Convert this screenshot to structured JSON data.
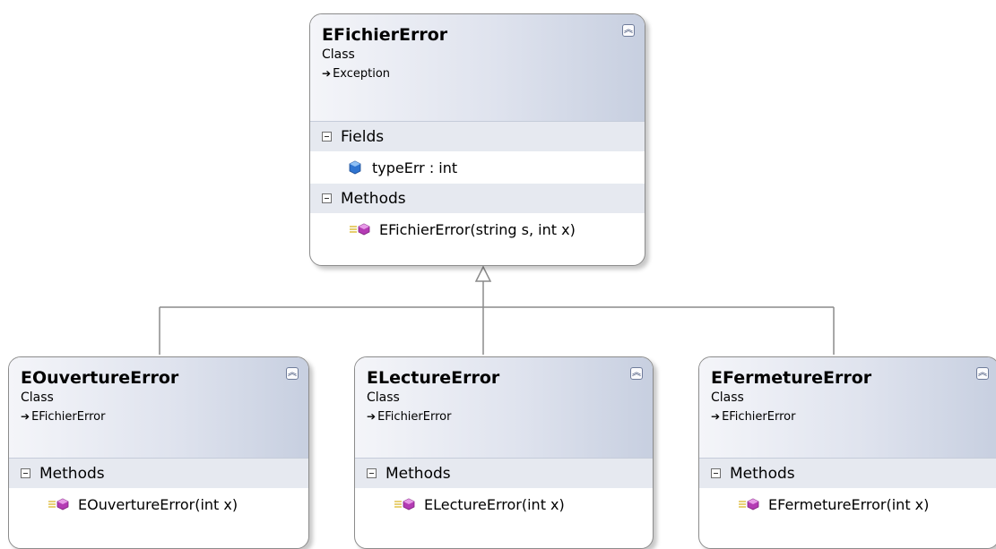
{
  "parent": {
    "name": "EFichierError",
    "kind": "Class",
    "base": "Exception",
    "sections": {
      "fields_label": "Fields",
      "fields": [
        "typeErr : int"
      ],
      "methods_label": "Methods",
      "methods": [
        "EFichierError(string s, int x)"
      ]
    }
  },
  "children": [
    {
      "name": "EOuvertureError",
      "kind": "Class",
      "base": "EFichierError",
      "methods_label": "Methods",
      "methods": [
        "EOuvertureError(int x)"
      ]
    },
    {
      "name": "ELectureError",
      "kind": "Class",
      "base": "EFichierError",
      "methods_label": "Methods",
      "methods": [
        "ELectureError(int x)"
      ]
    },
    {
      "name": "EFermetureError",
      "kind": "Class",
      "base": "EFichierError",
      "methods_label": "Methods",
      "methods": [
        "EFermetureError(int x)"
      ]
    }
  ],
  "icons": {
    "collapse": "double-chevron-up-icon",
    "inherits": "arrow-right-icon",
    "section_toggle": "minus-box-icon",
    "field": "field-icon",
    "method": "method-icon"
  }
}
